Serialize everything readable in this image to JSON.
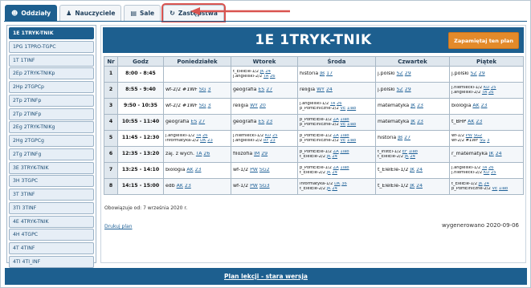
{
  "tabs": [
    {
      "label": "Oddziały",
      "icon": "users-icon"
    },
    {
      "label": "Nauczyciele",
      "icon": "user-icon"
    },
    {
      "label": "Sale",
      "icon": "building-icon"
    },
    {
      "label": "Zastępstwa",
      "icon": "refresh-icon"
    }
  ],
  "sidebar": {
    "items": [
      "1E 1TRYK-TNIK",
      "1PG 1TPRO-TGPC",
      "1T 1TINF",
      "2Ep 2TRYK-TNIKp",
      "2Hp 2TGPCp",
      "2Tp 2TINFp",
      "2Tp 2TINFp",
      "2Eg 2TRYK-TNIKg",
      "2Hg 2TGPCg",
      "2Tg 2TINFg",
      "3E 3TRYK-TNIK",
      "3H 3TGPC",
      "3T 3TINF",
      "3TI 3TINF",
      "4E 4TRYK-TNIK",
      "4H 4TGPC",
      "4T 4TINF",
      "4TI 4TI_INF"
    ]
  },
  "main": {
    "title": "1E 1TRYK-TNIK",
    "save_button": "Zapamiętaj ten plan",
    "headers": [
      "Nr",
      "Godz",
      "Poniedziałek",
      "Wtorek",
      "Środa",
      "Czwartek",
      "Piątek"
    ],
    "rows": [
      {
        "nr": "1",
        "godz": "8:00 - 8:45",
        "cells": [
          [],
          [
            [
              "t_ElelEle-1/2 ",
              "JK",
              "24"
            ],
            [
              "j.angielski-2/2 ",
              "TA",
              "26"
            ]
          ],
          [
            [
              "historia ",
              "JB",
              "17"
            ]
          ],
          [
            [
              "j.polski ",
              "SZ",
              "29"
            ]
          ],
          [
            [
              "j.polski ",
              "SZ",
              "29"
            ]
          ]
        ]
      },
      {
        "nr": "2",
        "godz": "8:55 - 9:40",
        "cells": [
          [
            [
              "wf-2/2 #1WF ",
              "SG",
              "3"
            ]
          ],
          [
            [
              "geografia ",
              "ES",
              "27"
            ]
          ],
          [
            [
              "religia ",
              "WY",
              "24"
            ]
          ],
          [
            [
              "j.polski ",
              "SZ",
              "29"
            ]
          ],
          [
            [
              "j.niemiecki-1/2 ",
              "KD",
              "25"
            ],
            [
              "j.angielski-2/2 ",
              "TA",
              "26"
            ]
          ]
        ]
      },
      {
        "nr": "3",
        "godz": "9:50 - 10:35",
        "cells": [
          [
            [
              "wf-2/2 #1WF ",
              "SG",
              "3"
            ]
          ],
          [
            [
              "religia ",
              "WY",
              "20"
            ]
          ],
          [
            [
              "j.angielski-1/2 ",
              "TA",
              "26"
            ],
            [
              "p_PomElniczne-2/2 ",
              "VE",
              "1lab"
            ]
          ],
          [
            [
              "matematyka ",
              "JK",
              "23"
            ]
          ],
          [
            [
              "biologia ",
              "AK",
              "23"
            ]
          ]
        ]
      },
      {
        "nr": "4",
        "godz": "10:55 - 11:40",
        "cells": [
          [
            [
              "geografia ",
              "ES",
              "27"
            ]
          ],
          [
            [
              "geografia ",
              "ES",
              "23"
            ]
          ],
          [
            [
              "p_PomElEle-1/2 ",
              "ZA",
              "1lab"
            ],
            [
              "p_PomElniczne-2/2 ",
              "VE",
              "1lab"
            ]
          ],
          [
            [
              "matematyka ",
              "JK",
              "23"
            ]
          ],
          [
            [
              "t_BHP ",
              "AK",
              "23"
            ]
          ]
        ]
      },
      {
        "nr": "5",
        "godz": "11:45 - 12:30",
        "cells": [
          [
            [
              "j.angielski-1/2 ",
              "TA",
              "26"
            ],
            [
              "informatyka-2/2 ",
              "DK",
              "23"
            ]
          ],
          [
            [
              "j.niemiecki-1/2 ",
              "KD",
              "25"
            ],
            [
              "j.angielski-2/2 ",
              "RY",
              "23"
            ]
          ],
          [
            [
              "p_PomElEle-1/2 ",
              "ZA",
              "1lab"
            ],
            [
              "p_PomElniczne-2/2 ",
              "VE",
              "1lab"
            ]
          ],
          [
            [
              "historia ",
              "JB",
              "27"
            ]
          ],
          [
            [
              "wf-1/2 ",
              "PW",
              "SG2"
            ],
            [
              "wf-2/2 #1WF ",
              "SG",
              "3"
            ]
          ]
        ]
      },
      {
        "nr": "6",
        "godz": "12:35 - 13:20",
        "cells": [
          [
            [
              "zaj. z wych. ",
              "TA",
              "26"
            ]
          ],
          [
            [
              "filozofia ",
              "IM",
              "29"
            ]
          ],
          [
            [
              "p_PomElEle-1/2 ",
              "ZA",
              "1lab"
            ],
            [
              "t_ElelEle-2/2 ",
              "JK",
              "24"
            ]
          ],
          [
            [
              "t_InstEl-1/2 ",
              "EF",
              "1lab"
            ],
            [
              "t_ElelEle-2/2 ",
              "JK",
              "24"
            ]
          ],
          [
            [
              "r_matematyka ",
              "JK",
              "24"
            ]
          ]
        ]
      },
      {
        "nr": "7",
        "godz": "13:25 - 14:10",
        "cells": [
          [
            [
              "biologia ",
              "AK",
              "23"
            ]
          ],
          [
            [
              "wf-1/2 ",
              "PW",
              "SG2"
            ]
          ],
          [
            [
              "p_PomElEle-1/2 ",
              "ZA",
              "1lab"
            ],
            [
              "t_ElelEle-2/2 ",
              "JK",
              "24"
            ]
          ],
          [
            [
              "t_ElelEle-1/2 ",
              "JK",
              "24"
            ]
          ],
          [
            [
              "j.angielski-1/2 ",
              "TA",
              "26"
            ],
            [
              "j.niemiecki-2/2 ",
              "KD",
              "25"
            ]
          ]
        ]
      },
      {
        "nr": "8",
        "godz": "14:15 - 15:00",
        "cells": [
          [
            [
              "edb ",
              "AK",
              "23"
            ]
          ],
          [
            [
              "wf-1/2 ",
              "PW",
              "SG3"
            ]
          ],
          [
            [
              "informatyka-1/2 ",
              "DK",
              "36"
            ],
            [
              "t_ElelEle-2/2 ",
              "JK",
              "24"
            ]
          ],
          [
            [
              "t_ElelEle-1/2 ",
              "JK",
              "24"
            ]
          ],
          [
            [
              "t_ElelEle-1/2 ",
              "JK",
              "24"
            ],
            [
              "p_PomElniczne-2/2 ",
              "VE",
              "1lab"
            ]
          ]
        ]
      }
    ],
    "footnote": "Obowiązuje od: 7 września 2020 r.",
    "print_link": "Drukuj plan",
    "generated": "wygenerowano 2020-09-06"
  },
  "footer": {
    "link": "Plan lekcji - stara wersja"
  },
  "colors": {
    "primary": "#1d5f8f",
    "accent": "#e38a2a",
    "highlight": "#d9534f"
  }
}
